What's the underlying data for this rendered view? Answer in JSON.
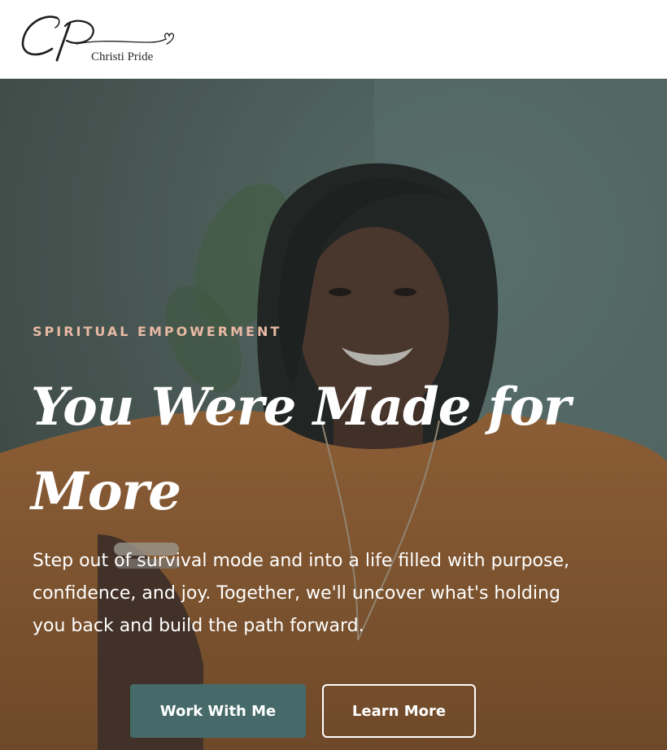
{
  "header": {
    "logo_text": "Christi Pride"
  },
  "hero": {
    "eyebrow": "SPIRITUAL EMPOWERMENT",
    "headline": "You Were Made for More",
    "subtext": "Step out of survival mode and into a life filled with purpose, confidence, and joy. Together, we'll uncover what's holding you back and build the path forward.",
    "primary_button": "Work With Me",
    "secondary_button": "Learn More"
  },
  "colors": {
    "eyebrow": "#e9b9a4",
    "primary_button_bg": "#456a69",
    "text": "#ffffff"
  },
  "icons": {
    "logo": "cp-monogram-heart-icon"
  }
}
